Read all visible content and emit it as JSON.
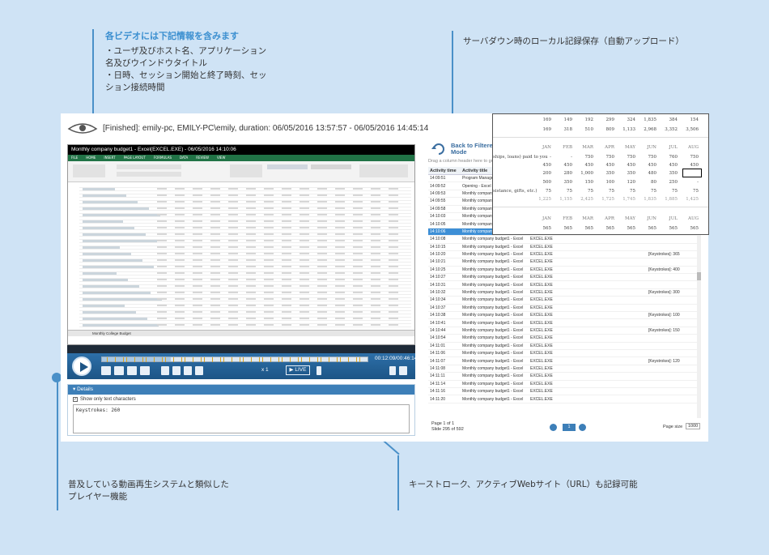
{
  "annotations": {
    "top_left_title": "各ビデオには下記情報を含みます",
    "top_left_body": [
      "・ユーザ及びホスト名、アプリケーション",
      "名及びウインドウタイトル",
      "・日時、セッション開始と終了時刻、セッ",
      "ション接続時間"
    ],
    "top_right": "サーバダウン時のローカル記録保存（自動アップロード）",
    "bottom_left": [
      "普及している動画再生システムと類似した",
      "プレイヤー機能"
    ],
    "bottom_right": "キーストローク、アクティブWebサイト（URL）も記録可能"
  },
  "session": {
    "title": "[Finished]: emily-pc, EMILY-PC\\emily, duration: 06/05/2016 13:57:57 - 06/05/2016 14:45:14"
  },
  "video": {
    "window_title": "Monthly company budget1 - Excel(EXCEL.EXE) - 06/05/2016 14:10:06",
    "ribbon_tabs": [
      "FILE",
      "HOME",
      "INSERT",
      "PAGE LAYOUT",
      "FORMULAS",
      "DATA",
      "REVIEW",
      "VIEW"
    ],
    "sheet_tab": "Monthly College Budget"
  },
  "player": {
    "timecode": "00:12:09/00:46:14",
    "live_label": "LIVE",
    "speed_label": "x 1",
    "progress_fraction": 0.26
  },
  "details": {
    "header": "Details",
    "checkbox_label": "Show only text characters",
    "checkbox_checked": true,
    "keystrokes": "Keystrokes: 260"
  },
  "activity": {
    "back_label_1": "Back to Filtere",
    "back_label_2": "Mode",
    "drag_hint": "Drag a column header here to gro",
    "col_time": "Activity time",
    "col_title": "Activity title",
    "rows": [
      {
        "time": "14:09:51",
        "title": "Program Manager",
        "app": "",
        "key": ""
      },
      {
        "time": "14:09:52",
        "title": "Opening - Excel",
        "app": "",
        "key": ""
      },
      {
        "time": "14:09:53",
        "title": "Monthly company b",
        "app": "",
        "key": ""
      },
      {
        "time": "14:09:55",
        "title": "Monthly company b",
        "app": "",
        "key": ""
      },
      {
        "time": "14:09:58",
        "title": "Monthly company b",
        "app": "",
        "key": ""
      },
      {
        "time": "14:10:03",
        "title": "Monthly company b",
        "app": "",
        "key": ""
      },
      {
        "time": "14:10:05",
        "title": "Monthly company b",
        "app": "",
        "key": ""
      },
      {
        "time": "14:10:06",
        "title": "Monthly company budget1 - Excel",
        "app": "EXCEL.EXE",
        "key": "[Keystrokes]: 260",
        "selected": true
      },
      {
        "time": "14:10:08",
        "title": "Monthly company budget1 - Excel",
        "app": "EXCEL.EXE",
        "key": ""
      },
      {
        "time": "14:10:15",
        "title": "Monthly company budget1 - Excel",
        "app": "EXCEL.EXE",
        "key": ""
      },
      {
        "time": "14:10:20",
        "title": "Monthly company budget1 - Excel",
        "app": "EXCEL.EXE",
        "key": "[Keystrokes]: 365"
      },
      {
        "time": "14:10:21",
        "title": "Monthly company budget1 - Excel",
        "app": "EXCEL.EXE",
        "key": ""
      },
      {
        "time": "14:10:25",
        "title": "Monthly company budget1 - Excel",
        "app": "EXCEL.EXE",
        "key": "[Keystrokes]: 400"
      },
      {
        "time": "14:10:27",
        "title": "Monthly company budget1 - Excel",
        "app": "EXCEL.EXE",
        "key": ""
      },
      {
        "time": "14:10:31",
        "title": "Monthly company budget1 - Excel",
        "app": "EXCEL.EXE",
        "key": ""
      },
      {
        "time": "14:10:32",
        "title": "Monthly company budget1 - Excel",
        "app": "EXCEL.EXE",
        "key": "[Keystrokes]: 300"
      },
      {
        "time": "14:10:34",
        "title": "Monthly company budget1 - Excel",
        "app": "EXCEL.EXE",
        "key": ""
      },
      {
        "time": "14:10:37",
        "title": "Monthly company budget1 - Excel",
        "app": "EXCEL.EXE",
        "key": ""
      },
      {
        "time": "14:10:38",
        "title": "Monthly company budget1 - Excel",
        "app": "EXCEL.EXE",
        "key": "[Keystrokes]: 100"
      },
      {
        "time": "14:10:41",
        "title": "Monthly company budget1 - Excel",
        "app": "EXCEL.EXE",
        "key": ""
      },
      {
        "time": "14:10:44",
        "title": "Monthly company budget1 - Excel",
        "app": "EXCEL.EXE",
        "key": "[Keystrokes]: 150"
      },
      {
        "time": "14:10:54",
        "title": "Monthly company budget1 - Excel",
        "app": "EXCEL.EXE",
        "key": ""
      },
      {
        "time": "14:11:01",
        "title": "Monthly company budget1 - Excel",
        "app": "EXCEL.EXE",
        "key": ""
      },
      {
        "time": "14:11:06",
        "title": "Monthly company budget1 - Excel",
        "app": "EXCEL.EXE",
        "key": ""
      },
      {
        "time": "14:11:07",
        "title": "Monthly company budget1 - Excel",
        "app": "EXCEL.EXE",
        "key": "[Keystrokes]: 120"
      },
      {
        "time": "14:11:08",
        "title": "Monthly company budget1 - Excel",
        "app": "EXCEL.EXE",
        "key": ""
      },
      {
        "time": "14:11:11",
        "title": "Monthly company budget1 - Excel",
        "app": "EXCEL.EXE",
        "key": ""
      },
      {
        "time": "14:11:14",
        "title": "Monthly company budget1 - Excel",
        "app": "EXCEL.EXE",
        "key": ""
      },
      {
        "time": "14:11:16",
        "title": "Monthly company budget1 - Excel",
        "app": "EXCEL.EXE",
        "key": ""
      },
      {
        "time": "14:11:20",
        "title": "Monthly company budget1 - Excel",
        "app": "EXCEL.EXE",
        "key": ""
      }
    ],
    "page_info": "Page 1 of 1",
    "slide_info": "Slide 295 of 592",
    "page_current": "1",
    "page_size_label": "Page size",
    "page_size_value": "1000"
  },
  "zoom": {
    "rows": [
      {
        "values": [
          "169",
          "149",
          "192",
          "299",
          "324",
          "1,835",
          "384",
          "154"
        ]
      },
      {
        "values": [
          "169",
          "318",
          "510",
          "809",
          "1,133",
          "2,968",
          "3,352",
          "3,506"
        ]
      }
    ],
    "months_1": [
      "JAN",
      "FEB",
      "MAR",
      "APR",
      "MAY",
      "JUN",
      "JUL",
      "AUG"
    ],
    "loan_label": "ships, loans) paid to you",
    "row_a": [
      "-",
      "-",
      "750",
      "750",
      "750",
      "750",
      "760",
      "750"
    ],
    "row_b": [
      "450",
      "450",
      "450",
      "450",
      "450",
      "450",
      "450",
      "450"
    ],
    "row_c": [
      "200",
      "280",
      "1,000",
      "350",
      "350",
      "480",
      "350",
      ""
    ],
    "row_d": [
      "500",
      "350",
      "150",
      "100",
      "120",
      "80",
      "250",
      "-"
    ],
    "assist_label": "sistance, gifts, etc.)",
    "row_e": [
      "75",
      "75",
      "75",
      "75",
      "75",
      "75",
      "75",
      "75"
    ],
    "row_f": [
      "1,225",
      "1,155",
      "2,425",
      "1,725",
      "1,745",
      "1,835",
      "1,885",
      "1,425"
    ],
    "months_2": [
      "JAN",
      "FEB",
      "MAR",
      "APR",
      "MAY",
      "JUN",
      "JUL",
      "AUG"
    ],
    "row_g": [
      "565",
      "565",
      "565",
      "565",
      "565",
      "565",
      "565",
      "565"
    ]
  }
}
